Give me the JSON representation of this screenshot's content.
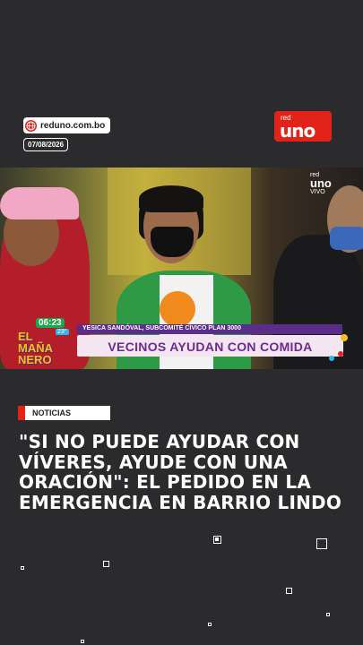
{
  "header": {
    "site": "reduno.com.bo",
    "date": "07/08/2026",
    "logo_small": "red",
    "logo_main": "uno"
  },
  "video": {
    "broadcaster_small": "red",
    "broadcaster_main": "uno",
    "live_label": "VIVO",
    "show": {
      "time": "06:23",
      "temp": "23°",
      "name_line1": "EL",
      "name_line2": "MAÑA",
      "name_line3": "NERO"
    },
    "lower_third": {
      "speaker": "YESICA SANDÓVAL, SUBCOMITÉ CÍVICO PLAN 3000",
      "caption": "VECINOS AYUDAN CON COMIDA"
    }
  },
  "article": {
    "category": "NOTICIAS",
    "headline": "\"SI NO PUEDE AYUDAR CON VÍVERES, AYUDE CON UNA ORACIÓN\": EL PEDIDO EN LA EMERGENCIA EN BARRIO LINDO"
  },
  "colors": {
    "brand": "#e2231a",
    "background": "#2b2a2c",
    "accent_purple": "#6a2c8e"
  },
  "icons": [
    "globe-icon"
  ]
}
